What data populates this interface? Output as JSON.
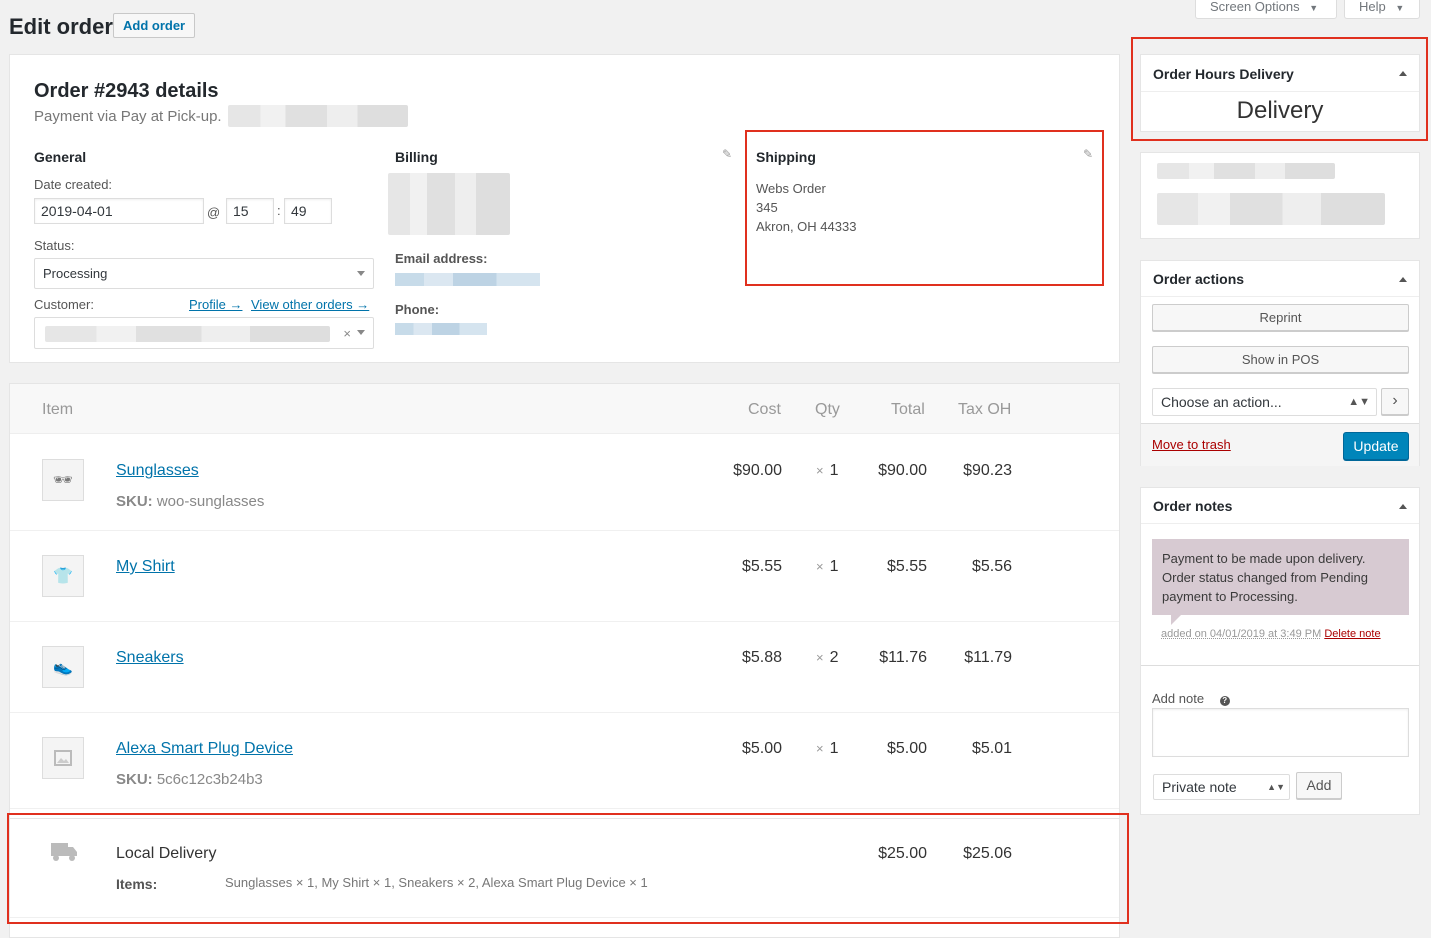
{
  "header": {
    "title": "Edit order",
    "add_order_label": "Add order",
    "screen_options_label": "Screen Options",
    "help_label": "Help"
  },
  "order": {
    "heading": "Order #2943 details",
    "payment_text": "Payment via Pay at Pick-up.",
    "general": {
      "heading": "General",
      "date_created_label": "Date created:",
      "date_value": "2019-04-01",
      "at_sign": "@",
      "hour_value": "15",
      "colon": ":",
      "minute_value": "49",
      "status_label": "Status:",
      "status_value": "Processing",
      "customer_label": "Customer:",
      "profile_link": "Profile →",
      "view_orders_link": "View other orders →",
      "clear_glyph": "×"
    },
    "billing": {
      "heading": "Billing",
      "email_label": "Email address:",
      "phone_label": "Phone:"
    },
    "shipping": {
      "heading": "Shipping",
      "line1": "Webs Order",
      "line2": "345",
      "line3": "Akron, OH 44333"
    }
  },
  "items_table": {
    "headers": {
      "item": "Item",
      "cost": "Cost",
      "qty": "Qty",
      "total": "Total",
      "tax": "Tax OH"
    },
    "qty_prefix": "×",
    "rows": [
      {
        "name": "Sunglasses",
        "sku_label": "SKU:",
        "sku": "woo-sunglasses",
        "cost": "$90.00",
        "qty": "1",
        "total": "$90.00",
        "tax": "$90.23",
        "icon": "sunglasses-icon"
      },
      {
        "name": "My Shirt",
        "sku_label": "",
        "sku": "",
        "cost": "$5.55",
        "qty": "1",
        "total": "$5.55",
        "tax": "$5.56",
        "icon": "shirt-icon"
      },
      {
        "name": "Sneakers",
        "sku_label": "",
        "sku": "",
        "cost": "$5.88",
        "qty": "2",
        "total": "$11.76",
        "tax": "$11.79",
        "icon": "sneakers-icon"
      },
      {
        "name": "Alexa Smart Plug Device",
        "sku_label": "SKU:",
        "sku": "5c6c12c3b24b3",
        "cost": "$5.00",
        "qty": "1",
        "total": "$5.00",
        "tax": "$5.01",
        "icon": "image-placeholder-icon"
      }
    ],
    "shipping_row": {
      "name": "Local Delivery",
      "items_label": "Items:",
      "items_value": "Sunglasses × 1, My Shirt × 1, Sneakers × 2, Alexa Smart Plug Device × 1",
      "total": "$25.00",
      "tax": "$25.06"
    }
  },
  "sidebar": {
    "hours_delivery": {
      "title": "Order Hours Delivery",
      "value": "Delivery"
    },
    "order_actions": {
      "title": "Order actions",
      "reprint_label": "Reprint",
      "show_pos_label": "Show in POS",
      "action_select": "Choose an action...",
      "go_glyph": "›",
      "trash_link": "Move to trash",
      "update_label": "Update"
    },
    "order_notes": {
      "title": "Order notes",
      "note_text": "Payment to be made upon delivery. Order status changed from Pending payment to Processing.",
      "note_meta": "added on 04/01/2019 at 3:49 PM",
      "delete_link": "Delete note",
      "add_note_label": "Add note",
      "help_glyph": "?",
      "note_type": "Private note",
      "add_button": "Add"
    }
  },
  "colors": {
    "accent": "#0073aa",
    "primary_button": "#0085ba",
    "highlight_box": "#e0301e",
    "note_background": "#d7cad2"
  }
}
